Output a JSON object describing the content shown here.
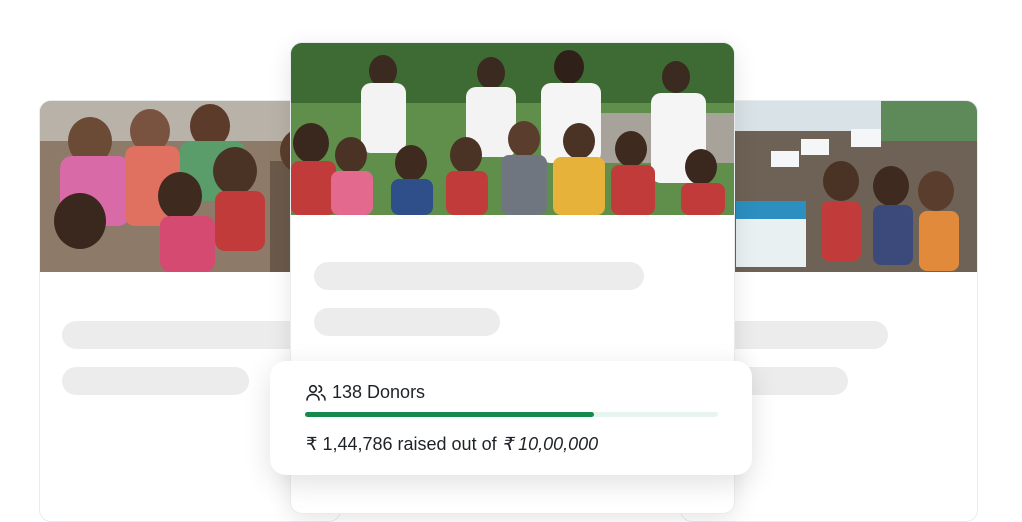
{
  "fundraiser": {
    "donors_label": "138 Donors",
    "raised_prefix": "₹ 1,44,786 raised out of",
    "goal_amount": "₹ 10,00,000",
    "progress_fraction": 0.7,
    "progress_color": "#168a4a",
    "track_color": "#e6f6ee"
  },
  "icons": {
    "donors": "users-icon"
  }
}
